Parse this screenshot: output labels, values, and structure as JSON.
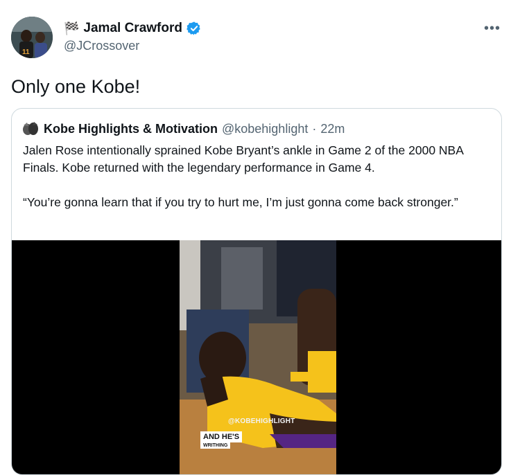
{
  "author": {
    "flag": "🏁",
    "name": "Jamal Crawford",
    "handle": "@JCrossover"
  },
  "more_label": "•••",
  "tweet_text": "Only one Kobe!",
  "quoted": {
    "name": "Kobe Highlights & Motivation",
    "handle": "@kobehighlight",
    "separator": "·",
    "time": "22m",
    "paragraphs": [
      "Jalen Rose intentionally sprained Kobe Bryant’s ankle in Game 2 of the 2000 NBA Finals. Kobe returned with the legendary performance in Game 4.",
      "“You’re gonna learn that if you try to hurt me, I’m just gonna come back stronger.”"
    ],
    "video": {
      "watermark": "@KOBEHIGHLIGHT",
      "caption_line1": "AND HE'S",
      "caption_line2": "WRITHING"
    }
  },
  "colors": {
    "verified": "#1d9bf0",
    "secondary_text": "#536471",
    "border": "#cfd9de",
    "lakers_gold": "#f5c21b",
    "lakers_purple": "#552583"
  }
}
